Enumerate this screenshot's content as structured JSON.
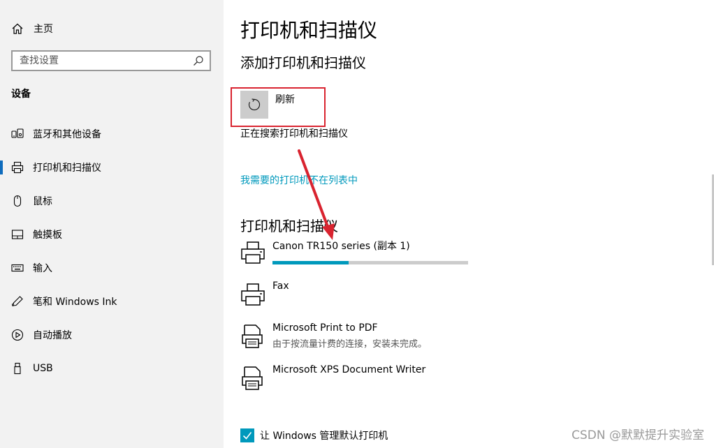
{
  "sidebar": {
    "home_label": "主页",
    "search_placeholder": "查找设置",
    "section_title": "设备",
    "items": [
      {
        "label": "蓝牙和其他设备",
        "icon": "bluetooth-icon"
      },
      {
        "label": "打印机和扫描仪",
        "icon": "printer-icon",
        "selected": true
      },
      {
        "label": "鼠标",
        "icon": "mouse-icon"
      },
      {
        "label": "触摸板",
        "icon": "touchpad-icon"
      },
      {
        "label": "输入",
        "icon": "keyboard-icon"
      },
      {
        "label": "笔和 Windows Ink",
        "icon": "pen-icon"
      },
      {
        "label": "自动播放",
        "icon": "autoplay-icon"
      },
      {
        "label": "USB",
        "icon": "usb-icon"
      }
    ]
  },
  "main": {
    "title": "打印机和扫描仪",
    "add_section_title": "添加打印机和扫描仪",
    "refresh_label": "刷新",
    "searching_text": "正在搜索打印机和扫描仪",
    "not_listed_link": "我需要的打印机不在列表中",
    "devices_section_title": "打印机和扫描仪",
    "devices": [
      {
        "name": "Canon TR150 series (副本 1)",
        "icon": "printer-icon",
        "progress": 0.39
      },
      {
        "name": "Fax",
        "icon": "printer-icon"
      },
      {
        "name": "Microsoft Print to PDF",
        "icon": "document-printer-icon",
        "status": "由于按流量计费的连接，安装未完成。"
      },
      {
        "name": "Microsoft XPS Document Writer",
        "icon": "document-printer-icon"
      }
    ],
    "default_printer_label": "让 Windows 管理默认打印机",
    "default_printer_checked": true
  },
  "watermark": "CSDN @默默提升实验室",
  "colors": {
    "accent": "#0099bc",
    "annotation": "#d9232f",
    "selected_bar": "#0f6cbd"
  }
}
